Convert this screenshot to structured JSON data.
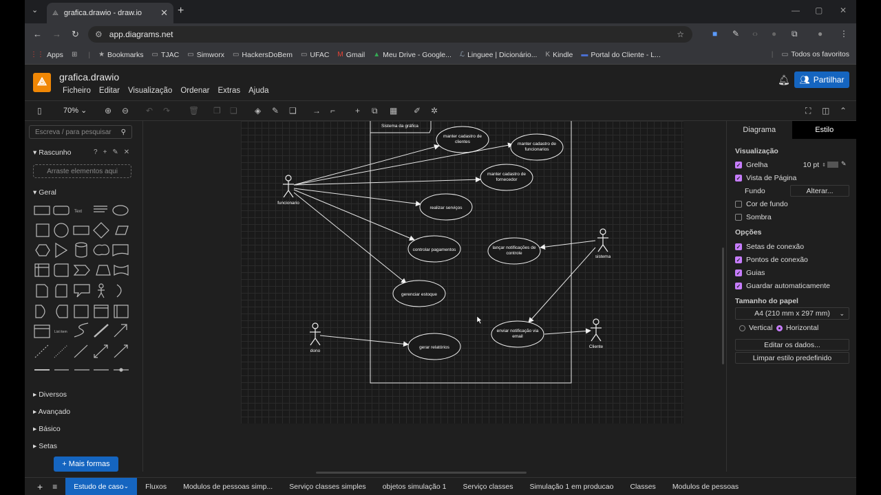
{
  "browser": {
    "tab_title": "grafica.drawio - draw.io",
    "url": "app.diagrams.net",
    "bookmarks": [
      {
        "icon": "apps-grid-icon",
        "label": "Apps"
      },
      {
        "icon": "grid-icon",
        "label": ""
      },
      {
        "icon": "star-icon",
        "label": "Bookmarks"
      },
      {
        "icon": "folder-icon",
        "label": "TJAC"
      },
      {
        "icon": "folder-icon",
        "label": "Simworx"
      },
      {
        "icon": "folder-icon",
        "label": "HackersDoBem"
      },
      {
        "icon": "folder-icon",
        "label": "UFAC"
      },
      {
        "icon": "gmail-icon",
        "label": "Gmail"
      },
      {
        "icon": "drive-icon",
        "label": "Meu Drive - Google..."
      },
      {
        "icon": "linguee-icon",
        "label": "Linguee | Dicionário..."
      },
      {
        "icon": "kindle-icon",
        "label": "Kindle"
      },
      {
        "icon": "portal-icon",
        "label": "Portal do Cliente - L..."
      }
    ],
    "all_bookmarks": "Todos os favoritos"
  },
  "app": {
    "file_title": "grafica.drawio",
    "menus": [
      "Ficheiro",
      "Editar",
      "Visualização",
      "Ordenar",
      "Extras",
      "Ajuda"
    ],
    "share_label": "Partilhar",
    "zoom": "70%"
  },
  "left_panel": {
    "search_placeholder": "Escreva / para pesquisar",
    "scratchpad": "Rascunho",
    "drop_hint": "Arraste elementos aqui",
    "general": "Geral",
    "sections": [
      "Diversos",
      "Avançado",
      "Básico",
      "Setas"
    ],
    "more_shapes": "+ Mais formas"
  },
  "diagram": {
    "system_label": "Sistema da gráfica",
    "actors": {
      "funcionario": "funcionario",
      "sistema": "sistema",
      "dono": "dono",
      "cliente": "Cliente"
    },
    "use_cases": {
      "uc1": [
        "manter cadastro de",
        "clientes"
      ],
      "uc2": [
        "manter cadastro de",
        "funcionarios"
      ],
      "uc3": [
        "manter cadastro de",
        "fornecedor"
      ],
      "uc4": [
        "realizar serviços"
      ],
      "uc5": [
        "controlar pagamentos"
      ],
      "uc6": [
        "lançar notificações de",
        "controle"
      ],
      "uc7": [
        "gerenciar estoque"
      ],
      "uc8": [
        "enviar notificação via",
        "email"
      ],
      "uc9": [
        "gerar relatórios"
      ]
    }
  },
  "right_panel": {
    "tabs": [
      "Diagrama",
      "Estilo"
    ],
    "view_heading": "Visualização",
    "grid": "Grelha",
    "grid_size": "10 pt",
    "page_view": "Vista de Página",
    "background": "Fundo",
    "change_btn": "Alterar...",
    "bg_color": "Cor de fundo",
    "shadow": "Sombra",
    "options_heading": "Opções",
    "opt1": "Setas de conexão",
    "opt2": "Pontos de conexão",
    "opt3": "Guias",
    "opt4": "Guardar automaticamente",
    "paper_heading": "Tamanho do papel",
    "paper_size": "A4 (210 mm x 297 mm)",
    "vertical": "Vertical",
    "horizontal": "Horizontal",
    "edit_data": "Editar os dados...",
    "clear_style": "Limpar estilo predefinido"
  },
  "page_tabs": [
    "Estudo de caso",
    "Fluxos",
    "Modulos de pessoas simp...",
    "Serviço classes simples",
    "objetos simulação 1",
    "Serviço classes",
    "Simulação 1 em producao",
    "Classes",
    "Modulos de pessoas"
  ],
  "colors": {
    "accent": "#1565c0",
    "checkbox": "#c77dff",
    "logo": "#f08705"
  }
}
